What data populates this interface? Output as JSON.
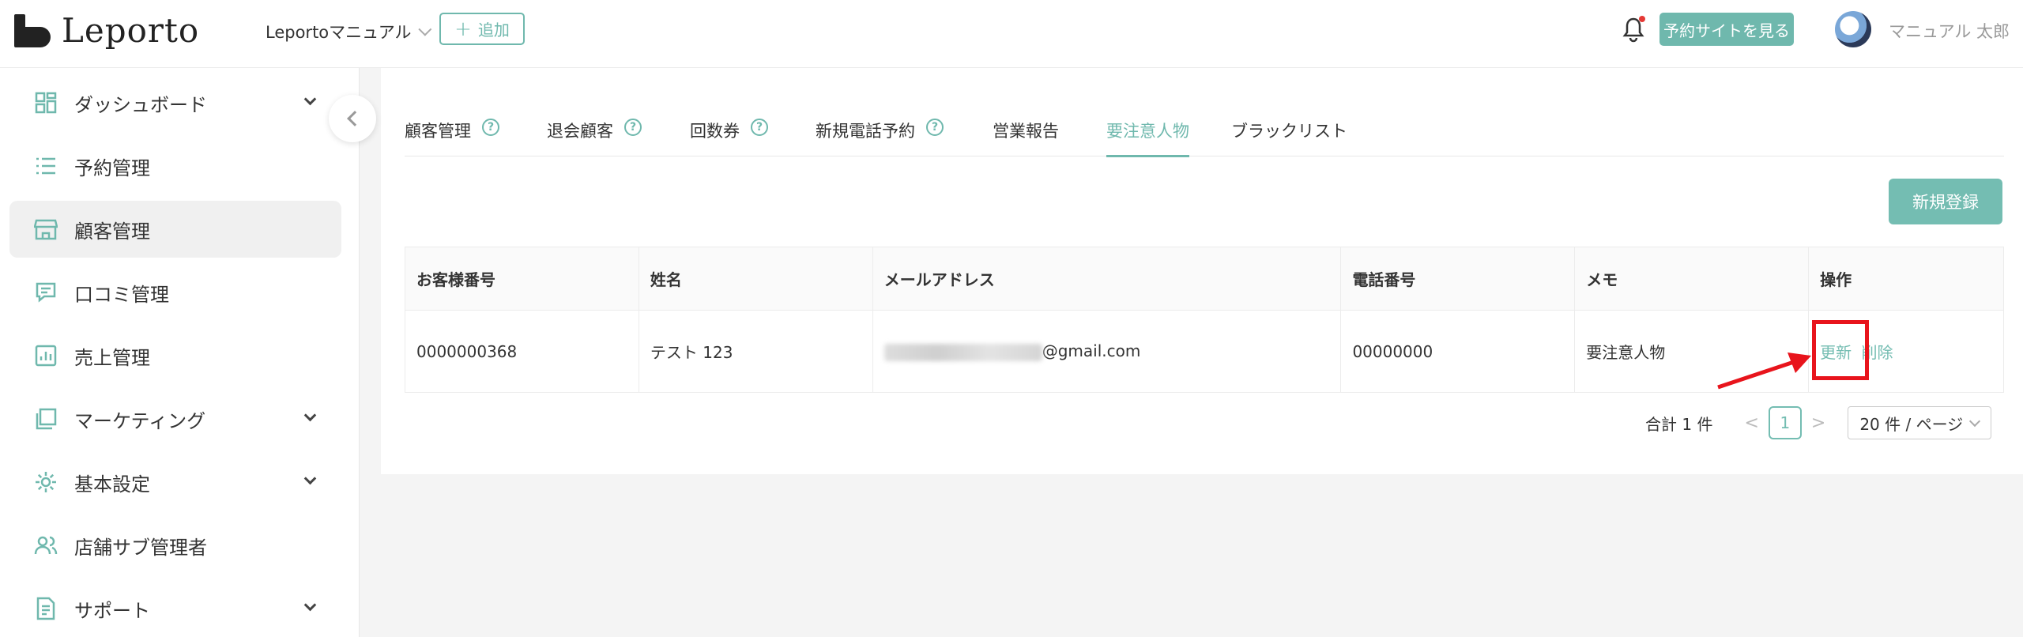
{
  "header": {
    "logo_text": "Leporto",
    "store_name": "Leportoマニュアル",
    "add_label": "追加",
    "site_button": "予約サイトを見る",
    "user_name": "マニュアル 太郎"
  },
  "sidebar": {
    "items": [
      {
        "label": "ダッシュボード",
        "icon": "dashboard-icon",
        "has_chevron": true
      },
      {
        "label": "予約管理",
        "icon": "list-icon",
        "has_chevron": false
      },
      {
        "label": "顧客管理",
        "icon": "store-icon",
        "has_chevron": false,
        "active": true
      },
      {
        "label": "口コミ管理",
        "icon": "comment-icon",
        "has_chevron": false
      },
      {
        "label": "売上管理",
        "icon": "chart-icon",
        "has_chevron": false
      },
      {
        "label": "マーケティング",
        "icon": "layers-icon",
        "has_chevron": true
      },
      {
        "label": "基本設定",
        "icon": "gear-icon",
        "has_chevron": true
      },
      {
        "label": "店舗サブ管理者",
        "icon": "users-icon",
        "has_chevron": false
      },
      {
        "label": "サポート",
        "icon": "support-icon",
        "has_chevron": true
      }
    ]
  },
  "tabs": [
    {
      "label": "顧客管理",
      "help": true
    },
    {
      "label": "退会顧客",
      "help": true
    },
    {
      "label": "回数券",
      "help": true
    },
    {
      "label": "新規電話予約",
      "help": true
    },
    {
      "label": "営業報告",
      "help": false
    },
    {
      "label": "要注意人物",
      "help": false,
      "active": true
    },
    {
      "label": "ブラックリスト",
      "help": false
    }
  ],
  "new_button": "新規登録",
  "table": {
    "headers": [
      "お客様番号",
      "姓名",
      "メールアドレス",
      "電話番号",
      "メモ",
      "操作"
    ],
    "rows": [
      {
        "customer_no": "0000000368",
        "name": "テスト 123",
        "email_suffix": "@gmail.com",
        "phone": "00000000",
        "memo": "要注意人物",
        "update": "更新",
        "delete": "削除"
      }
    ]
  },
  "pagination": {
    "total": "合計 1 件",
    "current": "1",
    "page_size": "20 件 / ページ"
  },
  "colors": {
    "accent": "#6fb8ad",
    "highlight": "#e8141c"
  }
}
